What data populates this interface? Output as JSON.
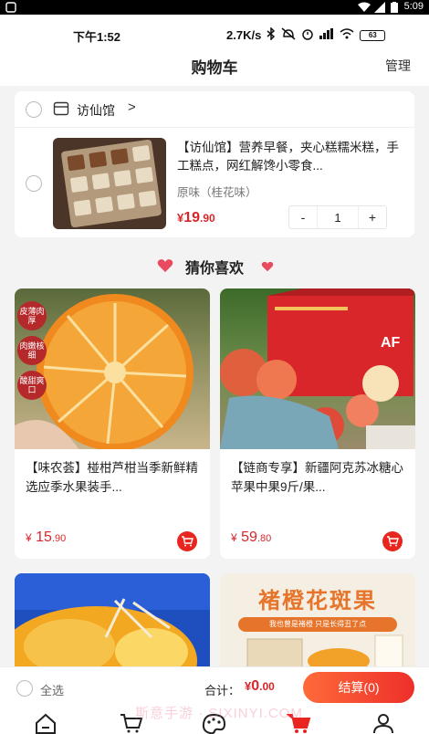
{
  "android_status": {
    "time": "5:09"
  },
  "phone_status": {
    "time": "下午1:52",
    "network_speed": "2.7K/s",
    "battery": "63"
  },
  "header": {
    "title": "购物车",
    "manage_label": "管理"
  },
  "cart": {
    "shop_name": "访仙馆",
    "shop_chevron": ">",
    "item": {
      "title": "【访仙馆】营养早餐，夹心糕糯米糕，手工糕点，网红解馋小零食...",
      "spec": "原味（桂花味）",
      "price_currency": "¥",
      "price_int": "19",
      "price_dec": ".90",
      "quantity": "1",
      "minus_label": "-",
      "plus_label": "+"
    }
  },
  "recommend": {
    "title": "猜你喜欢",
    "products": [
      {
        "title": "【味农荟】椪柑芦柑当季新鲜精选应季水果装手...",
        "currency": "¥",
        "price_int": "15",
        "price_dec": ".90",
        "tags": [
          "皮薄肉厚",
          "肉嫩核细",
          "酸甜爽口"
        ]
      },
      {
        "title": "【链商专享】新疆阿克苏冰糖心苹果中果9斤/果...",
        "currency": "¥",
        "price_int": "59",
        "price_dec": ".80",
        "box_text": "AF"
      },
      {
        "title": "",
        "currency": "",
        "price_int": "",
        "price_dec": ""
      },
      {
        "title": "",
        "banner_text": "褚橙花斑果",
        "banner_sub": "我也曾是褚橙  只是长得丑了点"
      }
    ]
  },
  "bottom_bar": {
    "select_all": "全选",
    "total_label": "合计：",
    "total_currency": "¥",
    "total_int": "0",
    "total_dec": ".00",
    "checkout": "结算(0)"
  },
  "watermark": "斯意手游 · SIXINYI.COM",
  "tabs": [
    {
      "icon": "home-icon"
    },
    {
      "icon": "cart-outline-icon"
    },
    {
      "icon": "palette-icon"
    },
    {
      "icon": "cart-active-icon"
    },
    {
      "icon": "profile-icon"
    }
  ],
  "colors": {
    "accent": "#e8261f",
    "price": "#d8262b",
    "checkout_start": "#ff6a3a",
    "checkout_end": "#ee2f2a"
  }
}
